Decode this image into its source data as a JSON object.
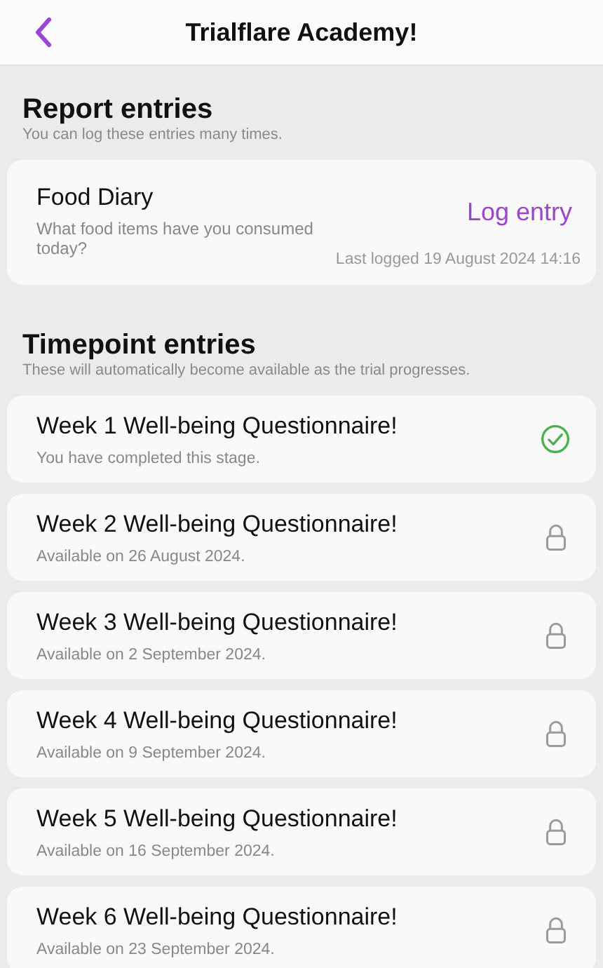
{
  "header": {
    "title": "Trialflare Academy!"
  },
  "report_section": {
    "title": "Report entries",
    "subtitle": "You can log these entries many times.",
    "entries": [
      {
        "title": "Food Diary",
        "description": "What food items have you consumed today?",
        "action": "Log entry",
        "last_logged": "Last logged 19 August 2024 14:16"
      }
    ]
  },
  "timepoint_section": {
    "title": "Timepoint entries",
    "subtitle": "These will automatically become available as the trial progresses.",
    "entries": [
      {
        "title": "Week 1 Well-being Questionnaire!",
        "note": "You have completed this stage.",
        "kind": "completed"
      },
      {
        "title": "Week 2 Well-being Questionnaire!",
        "note": "Available on 26 August 2024.",
        "kind": "locked"
      },
      {
        "title": "Week 3 Well-being Questionnaire!",
        "note": "Available on 2 September 2024.",
        "kind": "locked"
      },
      {
        "title": "Week 4 Well-being Questionnaire!",
        "note": "Available on 9 September 2024.",
        "kind": "locked"
      },
      {
        "title": "Week 5 Well-being Questionnaire!",
        "note": "Available on 16 September 2024.",
        "kind": "locked"
      },
      {
        "title": "Week 6 Well-being Questionnaire!",
        "note": "Available on 23 September 2024.",
        "kind": "locked"
      }
    ]
  }
}
